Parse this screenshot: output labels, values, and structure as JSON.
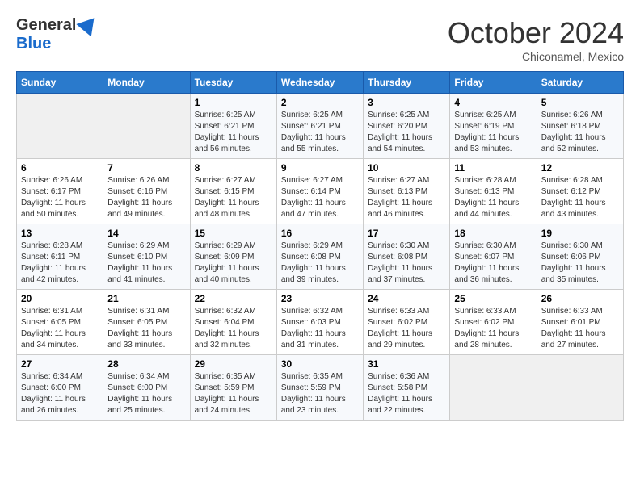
{
  "header": {
    "logo_line1": "General",
    "logo_line2": "Blue",
    "month": "October 2024",
    "location": "Chiconamel, Mexico"
  },
  "days_of_week": [
    "Sunday",
    "Monday",
    "Tuesday",
    "Wednesday",
    "Thursday",
    "Friday",
    "Saturday"
  ],
  "weeks": [
    [
      {
        "day": "",
        "sunrise": "",
        "sunset": "",
        "daylight": ""
      },
      {
        "day": "",
        "sunrise": "",
        "sunset": "",
        "daylight": ""
      },
      {
        "day": "1",
        "sunrise": "Sunrise: 6:25 AM",
        "sunset": "Sunset: 6:21 PM",
        "daylight": "Daylight: 11 hours and 56 minutes."
      },
      {
        "day": "2",
        "sunrise": "Sunrise: 6:25 AM",
        "sunset": "Sunset: 6:21 PM",
        "daylight": "Daylight: 11 hours and 55 minutes."
      },
      {
        "day": "3",
        "sunrise": "Sunrise: 6:25 AM",
        "sunset": "Sunset: 6:20 PM",
        "daylight": "Daylight: 11 hours and 54 minutes."
      },
      {
        "day": "4",
        "sunrise": "Sunrise: 6:25 AM",
        "sunset": "Sunset: 6:19 PM",
        "daylight": "Daylight: 11 hours and 53 minutes."
      },
      {
        "day": "5",
        "sunrise": "Sunrise: 6:26 AM",
        "sunset": "Sunset: 6:18 PM",
        "daylight": "Daylight: 11 hours and 52 minutes."
      }
    ],
    [
      {
        "day": "6",
        "sunrise": "Sunrise: 6:26 AM",
        "sunset": "Sunset: 6:17 PM",
        "daylight": "Daylight: 11 hours and 50 minutes."
      },
      {
        "day": "7",
        "sunrise": "Sunrise: 6:26 AM",
        "sunset": "Sunset: 6:16 PM",
        "daylight": "Daylight: 11 hours and 49 minutes."
      },
      {
        "day": "8",
        "sunrise": "Sunrise: 6:27 AM",
        "sunset": "Sunset: 6:15 PM",
        "daylight": "Daylight: 11 hours and 48 minutes."
      },
      {
        "day": "9",
        "sunrise": "Sunrise: 6:27 AM",
        "sunset": "Sunset: 6:14 PM",
        "daylight": "Daylight: 11 hours and 47 minutes."
      },
      {
        "day": "10",
        "sunrise": "Sunrise: 6:27 AM",
        "sunset": "Sunset: 6:13 PM",
        "daylight": "Daylight: 11 hours and 46 minutes."
      },
      {
        "day": "11",
        "sunrise": "Sunrise: 6:28 AM",
        "sunset": "Sunset: 6:13 PM",
        "daylight": "Daylight: 11 hours and 44 minutes."
      },
      {
        "day": "12",
        "sunrise": "Sunrise: 6:28 AM",
        "sunset": "Sunset: 6:12 PM",
        "daylight": "Daylight: 11 hours and 43 minutes."
      }
    ],
    [
      {
        "day": "13",
        "sunrise": "Sunrise: 6:28 AM",
        "sunset": "Sunset: 6:11 PM",
        "daylight": "Daylight: 11 hours and 42 minutes."
      },
      {
        "day": "14",
        "sunrise": "Sunrise: 6:29 AM",
        "sunset": "Sunset: 6:10 PM",
        "daylight": "Daylight: 11 hours and 41 minutes."
      },
      {
        "day": "15",
        "sunrise": "Sunrise: 6:29 AM",
        "sunset": "Sunset: 6:09 PM",
        "daylight": "Daylight: 11 hours and 40 minutes."
      },
      {
        "day": "16",
        "sunrise": "Sunrise: 6:29 AM",
        "sunset": "Sunset: 6:08 PM",
        "daylight": "Daylight: 11 hours and 39 minutes."
      },
      {
        "day": "17",
        "sunrise": "Sunrise: 6:30 AM",
        "sunset": "Sunset: 6:08 PM",
        "daylight": "Daylight: 11 hours and 37 minutes."
      },
      {
        "day": "18",
        "sunrise": "Sunrise: 6:30 AM",
        "sunset": "Sunset: 6:07 PM",
        "daylight": "Daylight: 11 hours and 36 minutes."
      },
      {
        "day": "19",
        "sunrise": "Sunrise: 6:30 AM",
        "sunset": "Sunset: 6:06 PM",
        "daylight": "Daylight: 11 hours and 35 minutes."
      }
    ],
    [
      {
        "day": "20",
        "sunrise": "Sunrise: 6:31 AM",
        "sunset": "Sunset: 6:05 PM",
        "daylight": "Daylight: 11 hours and 34 minutes."
      },
      {
        "day": "21",
        "sunrise": "Sunrise: 6:31 AM",
        "sunset": "Sunset: 6:05 PM",
        "daylight": "Daylight: 11 hours and 33 minutes."
      },
      {
        "day": "22",
        "sunrise": "Sunrise: 6:32 AM",
        "sunset": "Sunset: 6:04 PM",
        "daylight": "Daylight: 11 hours and 32 minutes."
      },
      {
        "day": "23",
        "sunrise": "Sunrise: 6:32 AM",
        "sunset": "Sunset: 6:03 PM",
        "daylight": "Daylight: 11 hours and 31 minutes."
      },
      {
        "day": "24",
        "sunrise": "Sunrise: 6:33 AM",
        "sunset": "Sunset: 6:02 PM",
        "daylight": "Daylight: 11 hours and 29 minutes."
      },
      {
        "day": "25",
        "sunrise": "Sunrise: 6:33 AM",
        "sunset": "Sunset: 6:02 PM",
        "daylight": "Daylight: 11 hours and 28 minutes."
      },
      {
        "day": "26",
        "sunrise": "Sunrise: 6:33 AM",
        "sunset": "Sunset: 6:01 PM",
        "daylight": "Daylight: 11 hours and 27 minutes."
      }
    ],
    [
      {
        "day": "27",
        "sunrise": "Sunrise: 6:34 AM",
        "sunset": "Sunset: 6:00 PM",
        "daylight": "Daylight: 11 hours and 26 minutes."
      },
      {
        "day": "28",
        "sunrise": "Sunrise: 6:34 AM",
        "sunset": "Sunset: 6:00 PM",
        "daylight": "Daylight: 11 hours and 25 minutes."
      },
      {
        "day": "29",
        "sunrise": "Sunrise: 6:35 AM",
        "sunset": "Sunset: 5:59 PM",
        "daylight": "Daylight: 11 hours and 24 minutes."
      },
      {
        "day": "30",
        "sunrise": "Sunrise: 6:35 AM",
        "sunset": "Sunset: 5:59 PM",
        "daylight": "Daylight: 11 hours and 23 minutes."
      },
      {
        "day": "31",
        "sunrise": "Sunrise: 6:36 AM",
        "sunset": "Sunset: 5:58 PM",
        "daylight": "Daylight: 11 hours and 22 minutes."
      },
      {
        "day": "",
        "sunrise": "",
        "sunset": "",
        "daylight": ""
      },
      {
        "day": "",
        "sunrise": "",
        "sunset": "",
        "daylight": ""
      }
    ]
  ]
}
